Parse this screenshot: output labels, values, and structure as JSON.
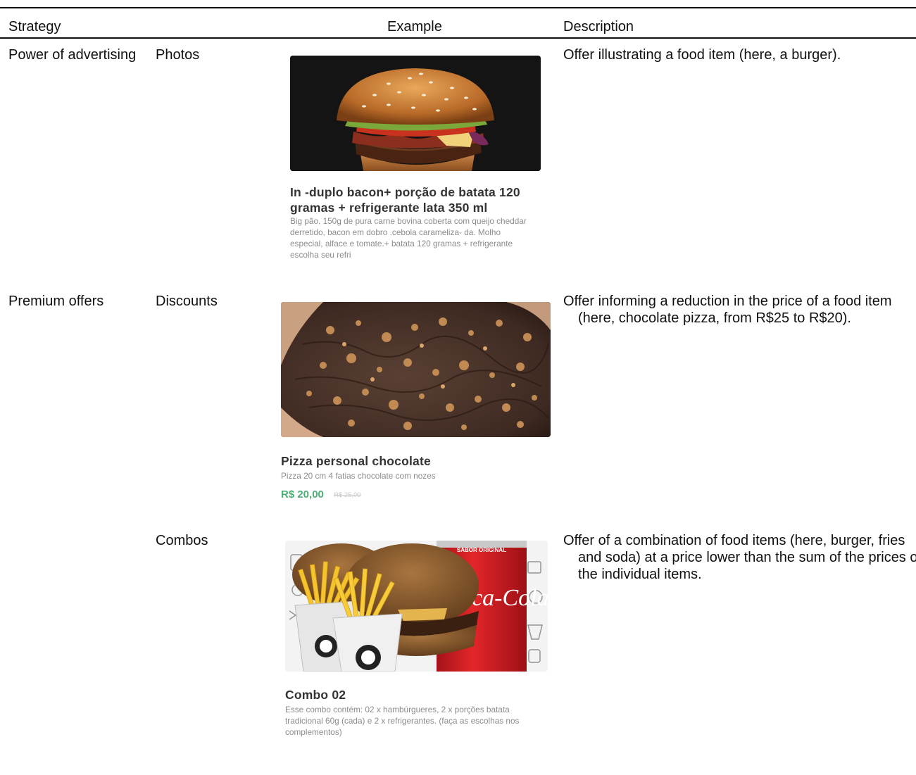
{
  "header": {
    "strategy": "Strategy",
    "example": "Example",
    "description": "Description"
  },
  "rows": [
    {
      "strategy": "Power of advertising",
      "subcategory": "Photos",
      "card": {
        "image": "burger-photo",
        "title": "In -duplo bacon+ porção de batata 120 gramas + refrigerante lata 350 ml",
        "description": "Big pão. 150g de pura carne bovina coberta com queijo cheddar derretido, bacon em dobro .cebola carameliza- da. Molho especial, alface e tomate.+ batata  120 gramas + refrigerante escolha seu refri"
      },
      "description": "Offer illustrating a food item (here, a burger)."
    },
    {
      "strategy": "Premium offers",
      "subcategory": "Discounts",
      "card": {
        "image": "chocolate-pizza-photo",
        "title": "Pizza personal chocolate",
        "description": "Pizza 20 cm 4 fatias chocolate com nozes",
        "price": "R$ 20,00",
        "old_price": "R$ 25,00"
      },
      "description": "Offer informing a reduction in the price of a food item (here, chocolate pizza, from R$25 to R$20)."
    },
    {
      "strategy": "",
      "subcategory": "Combos",
      "card": {
        "image": "combo-photo",
        "brand_text": "Coca-Cola",
        "can_label": "SABOR ORIGINAL",
        "title": "Combo 02",
        "description": "Esse combo contém: 02 x hambúrgueres, 2 x porções batata tradicional 60g (cada) e 2 x refrigerantes. (faça as escolhas nos complementos)"
      },
      "description": "Offer of a combination of food items (here, burger, fries and soda) at a price lower than the sum of the prices of the individual items."
    }
  ],
  "colors": {
    "price_green": "#4caf73",
    "burger_bg": "#141414",
    "pizza_chocolate": "#4a342a",
    "coke_red": "#d81d20"
  }
}
